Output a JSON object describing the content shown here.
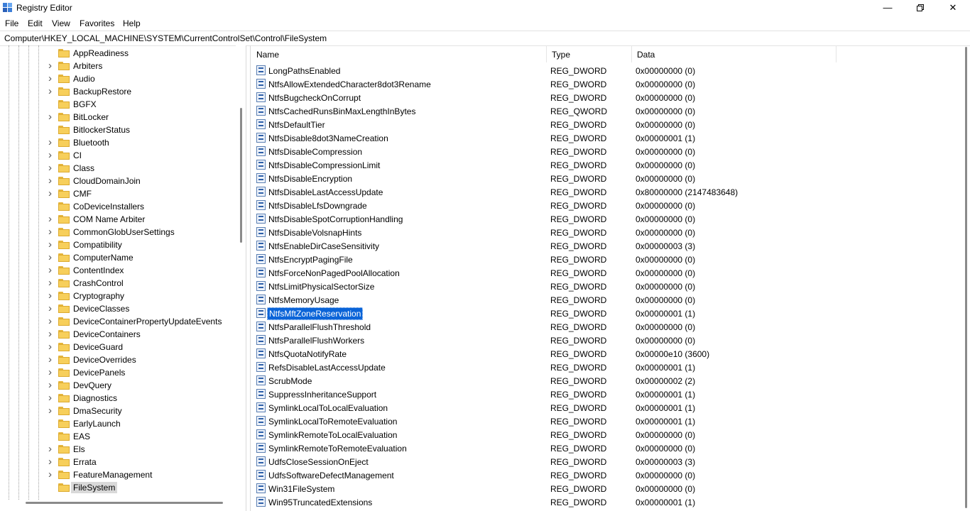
{
  "window": {
    "title": "Registry Editor"
  },
  "menu": [
    "File",
    "Edit",
    "View",
    "Favorites",
    "Help"
  ],
  "address": "Computer\\HKEY_LOCAL_MACHINE\\SYSTEM\\CurrentControlSet\\Control\\FileSystem",
  "tree": [
    {
      "label": "AppReadiness",
      "expand": false
    },
    {
      "label": "Arbiters",
      "expand": true
    },
    {
      "label": "Audio",
      "expand": true
    },
    {
      "label": "BackupRestore",
      "expand": true
    },
    {
      "label": "BGFX",
      "expand": false
    },
    {
      "label": "BitLocker",
      "expand": true
    },
    {
      "label": "BitlockerStatus",
      "expand": false
    },
    {
      "label": "Bluetooth",
      "expand": true
    },
    {
      "label": "CI",
      "expand": true
    },
    {
      "label": "Class",
      "expand": true
    },
    {
      "label": "CloudDomainJoin",
      "expand": true
    },
    {
      "label": "CMF",
      "expand": true
    },
    {
      "label": "CoDeviceInstallers",
      "expand": false
    },
    {
      "label": "COM Name Arbiter",
      "expand": true
    },
    {
      "label": "CommonGlobUserSettings",
      "expand": true
    },
    {
      "label": "Compatibility",
      "expand": true
    },
    {
      "label": "ComputerName",
      "expand": true
    },
    {
      "label": "ContentIndex",
      "expand": true
    },
    {
      "label": "CrashControl",
      "expand": true
    },
    {
      "label": "Cryptography",
      "expand": true
    },
    {
      "label": "DeviceClasses",
      "expand": true
    },
    {
      "label": "DeviceContainerPropertyUpdateEvents",
      "expand": true
    },
    {
      "label": "DeviceContainers",
      "expand": true
    },
    {
      "label": "DeviceGuard",
      "expand": true
    },
    {
      "label": "DeviceOverrides",
      "expand": true
    },
    {
      "label": "DevicePanels",
      "expand": true
    },
    {
      "label": "DevQuery",
      "expand": true
    },
    {
      "label": "Diagnostics",
      "expand": true
    },
    {
      "label": "DmaSecurity",
      "expand": true
    },
    {
      "label": "EarlyLaunch",
      "expand": false
    },
    {
      "label": "EAS",
      "expand": false
    },
    {
      "label": "Els",
      "expand": true
    },
    {
      "label": "Errata",
      "expand": true
    },
    {
      "label": "FeatureManagement",
      "expand": true
    },
    {
      "label": "FileSystem",
      "expand": false,
      "selected": true
    }
  ],
  "columns": {
    "name": "Name",
    "type": "Type",
    "data": "Data"
  },
  "values": [
    {
      "name": "LongPathsEnabled",
      "type": "REG_DWORD",
      "data": "0x00000000 (0)"
    },
    {
      "name": "NtfsAllowExtendedCharacter8dot3Rename",
      "type": "REG_DWORD",
      "data": "0x00000000 (0)"
    },
    {
      "name": "NtfsBugcheckOnCorrupt",
      "type": "REG_DWORD",
      "data": "0x00000000 (0)"
    },
    {
      "name": "NtfsCachedRunsBinMaxLengthInBytes",
      "type": "REG_QWORD",
      "data": "0x00000000 (0)"
    },
    {
      "name": "NtfsDefaultTier",
      "type": "REG_DWORD",
      "data": "0x00000000 (0)"
    },
    {
      "name": "NtfsDisable8dot3NameCreation",
      "type": "REG_DWORD",
      "data": "0x00000001 (1)"
    },
    {
      "name": "NtfsDisableCompression",
      "type": "REG_DWORD",
      "data": "0x00000000 (0)"
    },
    {
      "name": "NtfsDisableCompressionLimit",
      "type": "REG_DWORD",
      "data": "0x00000000 (0)"
    },
    {
      "name": "NtfsDisableEncryption",
      "type": "REG_DWORD",
      "data": "0x00000000 (0)"
    },
    {
      "name": "NtfsDisableLastAccessUpdate",
      "type": "REG_DWORD",
      "data": "0x80000000 (2147483648)"
    },
    {
      "name": "NtfsDisableLfsDowngrade",
      "type": "REG_DWORD",
      "data": "0x00000000 (0)"
    },
    {
      "name": "NtfsDisableSpotCorruptionHandling",
      "type": "REG_DWORD",
      "data": "0x00000000 (0)"
    },
    {
      "name": "NtfsDisableVolsnapHints",
      "type": "REG_DWORD",
      "data": "0x00000000 (0)"
    },
    {
      "name": "NtfsEnableDirCaseSensitivity",
      "type": "REG_DWORD",
      "data": "0x00000003 (3)"
    },
    {
      "name": "NtfsEncryptPagingFile",
      "type": "REG_DWORD",
      "data": "0x00000000 (0)"
    },
    {
      "name": "NtfsForceNonPagedPoolAllocation",
      "type": "REG_DWORD",
      "data": "0x00000000 (0)"
    },
    {
      "name": "NtfsLimitPhysicalSectorSize",
      "type": "REG_DWORD",
      "data": "0x00000000 (0)"
    },
    {
      "name": "NtfsMemoryUsage",
      "type": "REG_DWORD",
      "data": "0x00000000 (0)"
    },
    {
      "name": "NtfsMftZoneReservation",
      "type": "REG_DWORD",
      "data": "0x00000001 (1)",
      "selected": true
    },
    {
      "name": "NtfsParallelFlushThreshold",
      "type": "REG_DWORD",
      "data": "0x00000000 (0)"
    },
    {
      "name": "NtfsParallelFlushWorkers",
      "type": "REG_DWORD",
      "data": "0x00000000 (0)"
    },
    {
      "name": "NtfsQuotaNotifyRate",
      "type": "REG_DWORD",
      "data": "0x00000e10 (3600)"
    },
    {
      "name": "RefsDisableLastAccessUpdate",
      "type": "REG_DWORD",
      "data": "0x00000001 (1)"
    },
    {
      "name": "ScrubMode",
      "type": "REG_DWORD",
      "data": "0x00000002 (2)"
    },
    {
      "name": "SuppressInheritanceSupport",
      "type": "REG_DWORD",
      "data": "0x00000001 (1)"
    },
    {
      "name": "SymlinkLocalToLocalEvaluation",
      "type": "REG_DWORD",
      "data": "0x00000001 (1)"
    },
    {
      "name": "SymlinkLocalToRemoteEvaluation",
      "type": "REG_DWORD",
      "data": "0x00000001 (1)"
    },
    {
      "name": "SymlinkRemoteToLocalEvaluation",
      "type": "REG_DWORD",
      "data": "0x00000000 (0)"
    },
    {
      "name": "SymlinkRemoteToRemoteEvaluation",
      "type": "REG_DWORD",
      "data": "0x00000000 (0)"
    },
    {
      "name": "UdfsCloseSessionOnEject",
      "type": "REG_DWORD",
      "data": "0x00000003 (3)"
    },
    {
      "name": "UdfsSoftwareDefectManagement",
      "type": "REG_DWORD",
      "data": "0x00000000 (0)"
    },
    {
      "name": "Win31FileSystem",
      "type": "REG_DWORD",
      "data": "0x00000000 (0)"
    },
    {
      "name": "Win95TruncatedExtensions",
      "type": "REG_DWORD",
      "data": "0x00000001 (1)"
    }
  ],
  "icons": {
    "app": "registry-editor-icon",
    "minimize": "minimize-icon",
    "maximize": "restore-icon",
    "close": "close-icon",
    "folder": "folder-icon",
    "expand": "chevron-right-icon",
    "value": "reg-binary-value-icon"
  },
  "colors": {
    "selection": "#0a64d8",
    "folder": "#f7cf5b",
    "tree_selection": "#d9d9d9"
  }
}
